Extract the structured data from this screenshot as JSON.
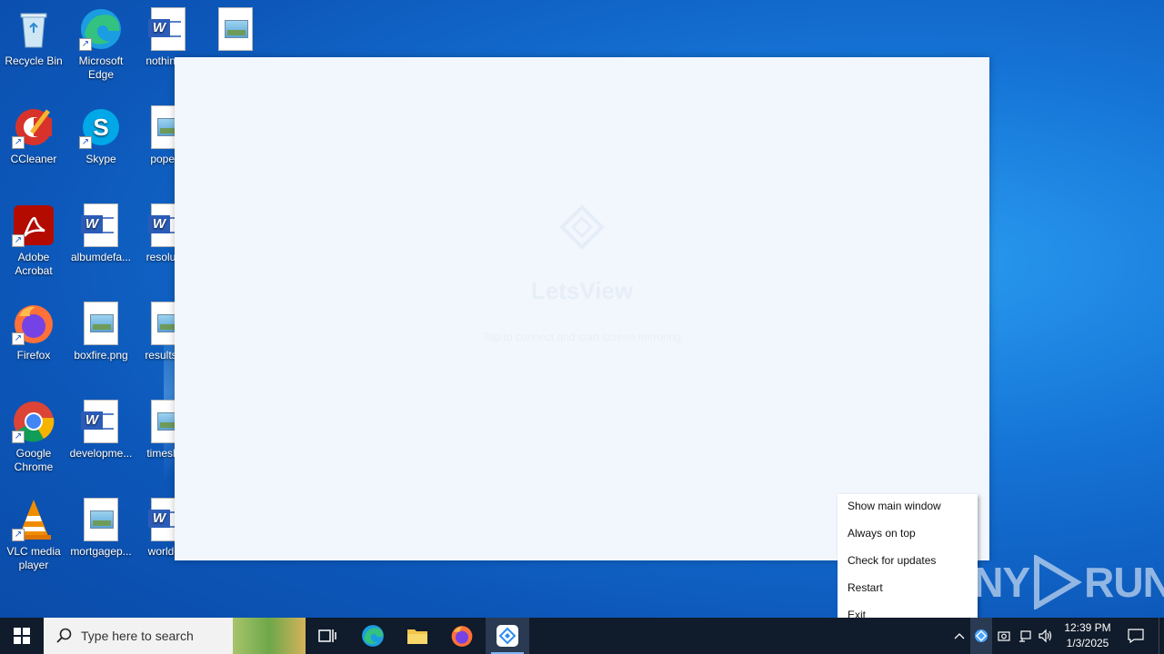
{
  "desktop": {
    "icons": [
      {
        "label": "Recycle Bin"
      },
      {
        "label": "Microsoft Edge"
      },
      {
        "label": "nothing..."
      },
      {
        "label": ""
      },
      {
        "label": "CCleaner"
      },
      {
        "label": "Skype"
      },
      {
        "label": "popel..."
      },
      {
        "label": "Adobe Acrobat"
      },
      {
        "label": "albumdefa..."
      },
      {
        "label": "resoluti..."
      },
      {
        "label": "Firefox"
      },
      {
        "label": "boxfire.png"
      },
      {
        "label": "resultsc..."
      },
      {
        "label": "Google Chrome"
      },
      {
        "label": "developme..."
      },
      {
        "label": "timeslit..."
      },
      {
        "label": "VLC media player"
      },
      {
        "label": "mortgagep..."
      },
      {
        "label": "worldc..."
      }
    ]
  },
  "main_window": {
    "app_name": "LetsView",
    "subtitle": "Tap to connect and start screen mirroring"
  },
  "context_menu": {
    "items": [
      {
        "label": "Show main window"
      },
      {
        "label": "Always on top"
      },
      {
        "label": "Check for updates"
      },
      {
        "label": "Restart"
      },
      {
        "label": "Exit"
      }
    ]
  },
  "watermark": {
    "text_left": "ANY",
    "text_right": "RUN"
  },
  "taskbar": {
    "search_placeholder": "Type here to search",
    "clock_time": "12:39 PM",
    "clock_date": "1/3/2025"
  },
  "colors": {
    "taskbar_bg": "#101b2b",
    "desktop_accent": "#1574d6",
    "window_bg": "#f2f7fd"
  }
}
